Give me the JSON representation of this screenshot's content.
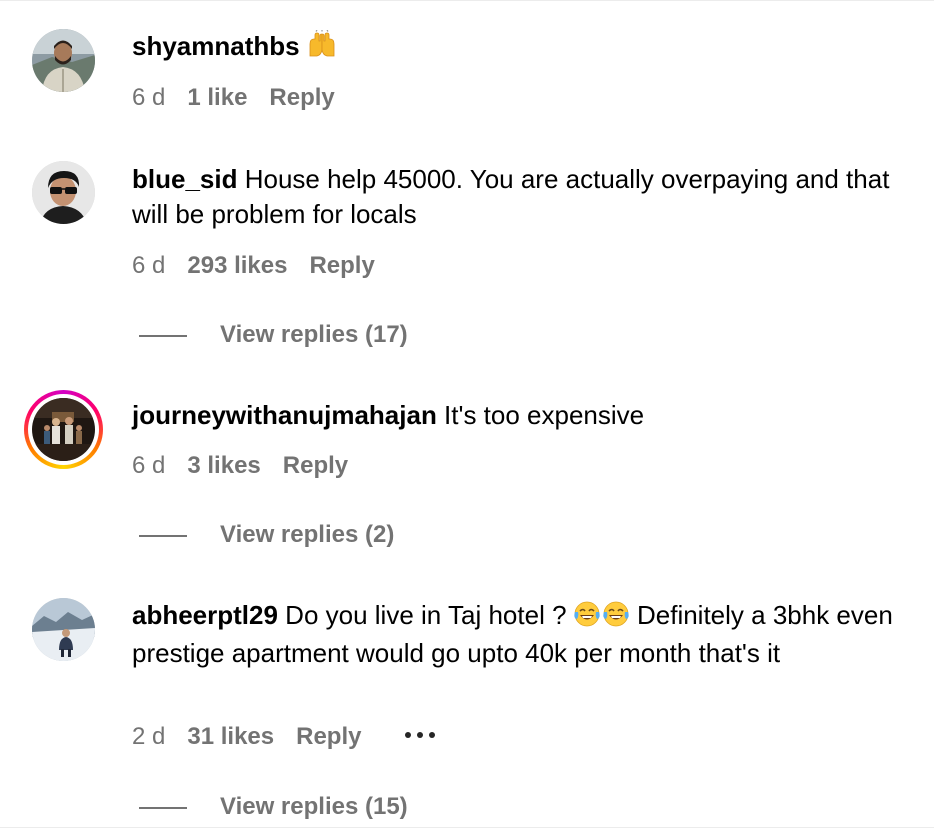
{
  "comments": [
    {
      "username": "shyamnathbs",
      "text": "",
      "emoji": "raising-hands",
      "time": "6 d",
      "likes": "1 like",
      "reply": "Reply",
      "view_replies": ""
    },
    {
      "username": "blue_sid",
      "text": " House help 45000. You are actually overpaying and that will be problem for locals",
      "time": "6 d",
      "likes": "293 likes",
      "reply": "Reply",
      "view_replies": "View replies (17)"
    },
    {
      "username": "journeywithanujmahajan",
      "text": " It's too expensive",
      "time": "6 d",
      "likes": "3 likes",
      "reply": "Reply",
      "view_replies": "View replies (2)",
      "has_story_ring": true
    },
    {
      "username": "abheerptl29",
      "text_before_emoji": " Do you live in Taj hotel ? ",
      "emoji": "tears-of-joy x2",
      "text_after_emoji": " Definitely a 3bhk even prestige apartment would go upto 40k per month that's it",
      "time": "2 d",
      "likes": "31 likes",
      "reply": "Reply",
      "more": "more-options",
      "view_replies": "View replies (15)"
    }
  ],
  "colors": {
    "text": "#000000",
    "secondary": "#737373",
    "story_ring_start": "#d300c5",
    "story_ring_end": "#ffd600"
  }
}
